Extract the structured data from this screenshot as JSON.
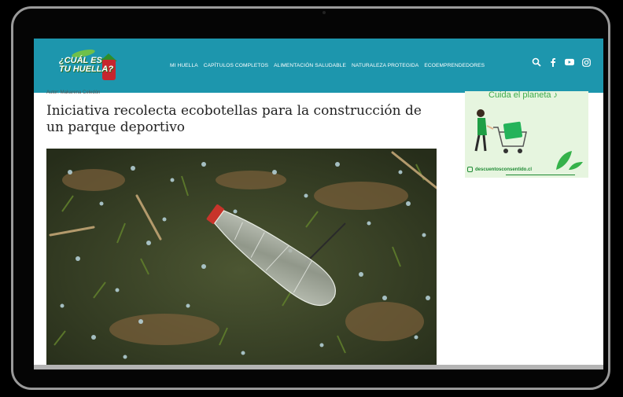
{
  "logo": {
    "line1": "¿CUÁL ES",
    "line2": "TU HUELLA?"
  },
  "nav": {
    "items": [
      "MI HUELLA",
      "CAPÍTULOS COMPLETOS",
      "ALIMENTACIÓN SALUDABLE",
      "NATURALEZA PROTEGIDA",
      "ECOEMPRENDEDORES"
    ],
    "icons": [
      "search-icon",
      "facebook-icon",
      "youtube-icon",
      "instagram-icon"
    ]
  },
  "article": {
    "author": "Autor: Makarena Celedón",
    "title": "Iniciativa recolecta ecobotellas para la construcción de un parque deportivo"
  },
  "ad": {
    "headline": "Cuida el planeta ♪",
    "handle": "descuentosconsentido.cl"
  },
  "colors": {
    "nav_bg": "#1d96ad",
    "ad_bg": "#e6f5df",
    "ad_green": "#1f8a34"
  }
}
